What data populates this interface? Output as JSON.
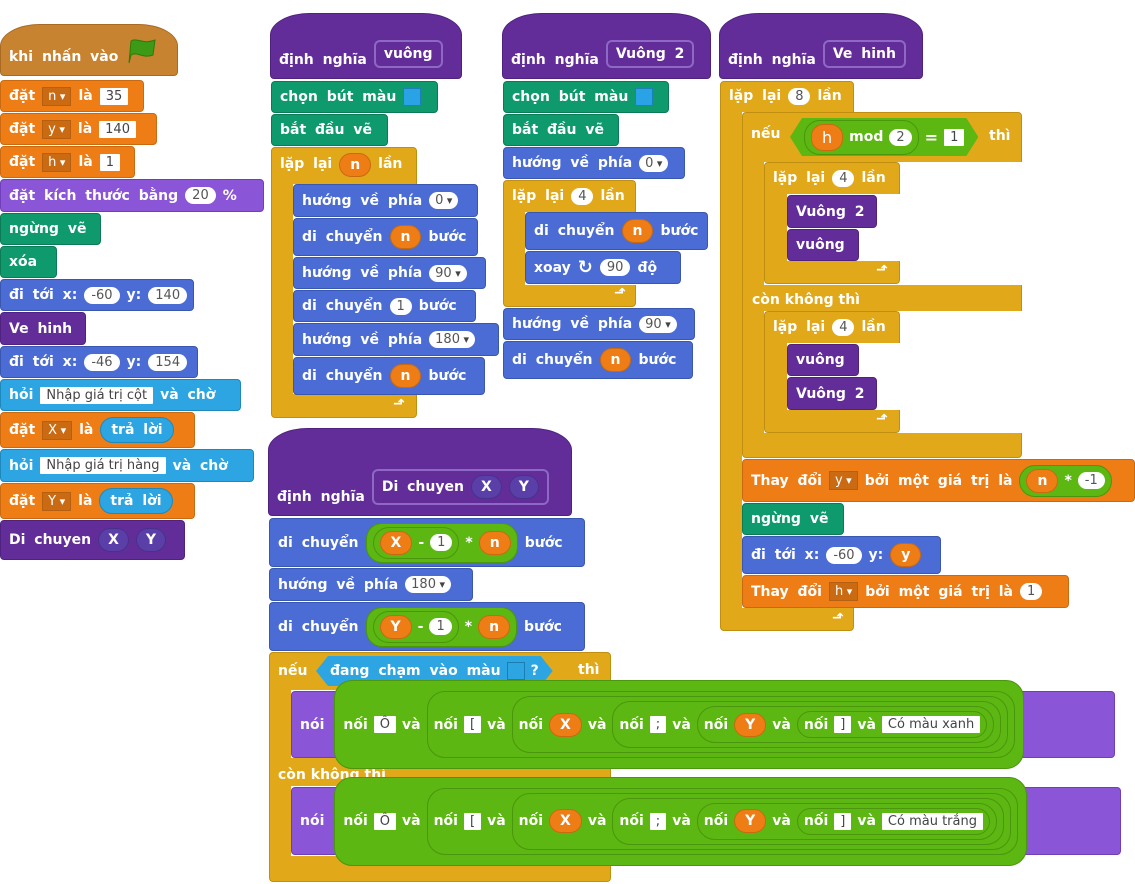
{
  "colors": {
    "events": "#c88330",
    "data": "#ee7d16",
    "looks": "#8a55d7",
    "pen": "#0e9a6c",
    "motion": "#4a6cd4",
    "sensing": "#2ca5e2",
    "more_blocks": "#632d99",
    "control": "#e1a91a",
    "operators": "#5cb712",
    "pen_color": "#2aa3e6"
  },
  "main_script": {
    "hat": "khi nhấn vào",
    "hat_icon": "green-flag-icon",
    "set_n": {
      "label": "đặt",
      "var": "n",
      "mid": "là",
      "value": "35"
    },
    "set_y": {
      "label": "đặt",
      "var": "y",
      "mid": "là",
      "value": "140"
    },
    "set_h": {
      "label": "đặt",
      "var": "h",
      "mid": "là",
      "value": "1"
    },
    "set_size": {
      "label": "đặt kích thước bằng",
      "value": "20",
      "suffix": "%"
    },
    "pen_up": "ngừng vẽ",
    "clear": "xóa",
    "goto1": {
      "label": "đi tới x:",
      "x": "-60",
      "ylabel": "y:",
      "y": "140"
    },
    "ve_hinh": "Ve hinh",
    "goto2": {
      "label": "đi tới x:",
      "x": "-46",
      "ylabel": "y:",
      "y": "154"
    },
    "ask1": {
      "label": "hỏi",
      "value": "Nhập giá trị cột",
      "suffix": "và chờ"
    },
    "set_X": {
      "label": "đặt",
      "var": "X",
      "mid": "là",
      "reporter": "trả lời"
    },
    "ask2": {
      "label": "hỏi",
      "value": "Nhập giá trị hàng",
      "suffix": "và chờ"
    },
    "set_Y": {
      "label": "đặt",
      "var": "Y",
      "mid": "là",
      "reporter": "trả lời"
    },
    "call": {
      "label": "Di chuyen",
      "arg1": "X",
      "arg2": "Y"
    }
  },
  "def_vuong": {
    "define": "định nghĩa",
    "name": "vuông",
    "pen_color": "chọn bút màu",
    "pen_down": "bắt đầu vẽ",
    "repeat": {
      "label": "lặp lại",
      "value": "n",
      "suffix": "lần"
    },
    "body": [
      {
        "label": "hướng về phía",
        "value": "0"
      },
      {
        "label": "di chuyển",
        "var": "n",
        "suffix": "bước"
      },
      {
        "label": "hướng về phía",
        "value": "90"
      },
      {
        "label": "di chuyển",
        "value": "1",
        "suffix": "bước"
      },
      {
        "label": "hướng về phía",
        "value": "180"
      },
      {
        "label": "di chuyển",
        "var": "n",
        "suffix": "bước"
      }
    ]
  },
  "def_vuong2": {
    "define": "định nghĩa",
    "name": "Vuông 2",
    "pen_color": "chọn bút màu",
    "pen_down": "bắt đầu vẽ",
    "point": {
      "label": "hướng về phía",
      "value": "0"
    },
    "repeat": {
      "label": "lặp lại",
      "value": "4",
      "suffix": "lần"
    },
    "move": {
      "label": "di chuyển",
      "var": "n",
      "suffix": "bước"
    },
    "turn": {
      "label": "xoay",
      "value": "90",
      "suffix": "độ"
    },
    "point2": {
      "label": "hướng về phía",
      "value": "90"
    },
    "move2": {
      "label": "di chuyển",
      "var": "n",
      "suffix": "bước"
    }
  },
  "def_ve_hinh": {
    "define": "định nghĩa",
    "name": "Ve hinh",
    "repeat": {
      "label": "lặp lại",
      "value": "8",
      "suffix": "lần"
    },
    "if": {
      "label": "nếu",
      "var": "h",
      "op": "mod",
      "mod_value": "2",
      "eq": "=",
      "eq_value": "1",
      "then": "thì"
    },
    "inner_repeat1": {
      "label": "lặp lại",
      "value": "4",
      "suffix": "lần"
    },
    "call_a1": "Vuông 2",
    "call_a2": "vuông",
    "else": "còn không thì",
    "inner_repeat2": {
      "label": "lặp lại",
      "value": "4",
      "suffix": "lần"
    },
    "call_b1": "vuông",
    "call_b2": "Vuông 2",
    "change_y": {
      "label": "Thay đổi",
      "var": "y",
      "mid": "bởi một giá trị là",
      "reporter": "n",
      "op": "*",
      "value": "-1"
    },
    "pen_up": "ngừng vẽ",
    "goto": {
      "label": "đi tới x:",
      "x": "-60",
      "ylabel": "y:",
      "reporter": "y"
    },
    "change_h": {
      "label": "Thay đổi",
      "var": "h",
      "mid": "bởi một giá trị là",
      "value": "1"
    }
  },
  "def_di_chuyen": {
    "define": "định nghĩa",
    "name": "Di chuyen",
    "arg1": "X",
    "arg2": "Y",
    "move1": {
      "label": "di chuyển",
      "var": "X",
      "minus": "-",
      "value": "1",
      "times": "*",
      "var2": "n",
      "suffix": "bước"
    },
    "point": {
      "label": "hướng về phía",
      "value": "180"
    },
    "move2": {
      "label": "di chuyển",
      "var": "Y",
      "minus": "-",
      "value": "1",
      "times": "*",
      "var2": "n",
      "suffix": "bước"
    },
    "if": {
      "label": "nếu",
      "cond": "đang chạm vào màu",
      "q": "?",
      "then": "thì"
    },
    "say1": {
      "label": "nói",
      "join": "nối",
      "and": "và",
      "p1": "Ô",
      "p2": "[",
      "p3": "X",
      "p4": ";",
      "p5": "Y",
      "p6": "]",
      "last": "Có màu xanh"
    },
    "else": "còn không thì",
    "say2": {
      "label": "nói",
      "join": "nối",
      "and": "và",
      "p1": "Ô",
      "p2": "[",
      "p3": "X",
      "p4": ";",
      "p5": "Y",
      "p6": "]",
      "last": "Có màu trắng"
    }
  }
}
